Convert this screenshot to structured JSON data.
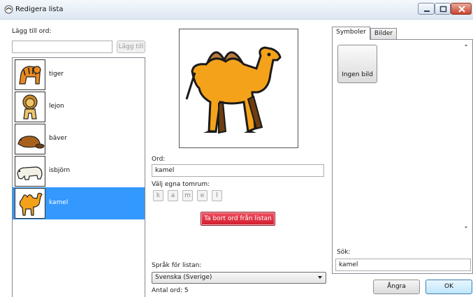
{
  "window": {
    "title": "Redigera lista"
  },
  "add_word": {
    "label": "Lägg till ord:",
    "input_value": "",
    "button": "Lägg till"
  },
  "word_list": [
    {
      "word": "tiger",
      "icon": "tiger-icon",
      "selected": false
    },
    {
      "word": "lejon",
      "icon": "lion-icon",
      "selected": false
    },
    {
      "word": "bäver",
      "icon": "beaver-icon",
      "selected": false
    },
    {
      "word": "isbjörn",
      "icon": "polar-bear-icon",
      "selected": false
    },
    {
      "word": "kamel",
      "icon": "camel-icon",
      "selected": true
    }
  ],
  "editor": {
    "preview_icon": "camel-icon",
    "word_label": "Ord:",
    "word_value": "kamel",
    "spaces_label": "Välj egna tomrum:",
    "letters": [
      "k",
      "a",
      "m",
      "e",
      "l"
    ],
    "remove_button": "Ta bort ord från listan"
  },
  "language": {
    "label": "Språk för listan:",
    "selected": "Svenska (Sverige)"
  },
  "count": {
    "text": "Antal ord: 5"
  },
  "tabs": {
    "items": [
      "Symboler",
      "Bilder"
    ],
    "active": "Symboler",
    "no_image_button": "Ingen bild",
    "search_label": "Sök:",
    "search_value": "kamel"
  },
  "footer": {
    "undo_button": "Ångra",
    "ok_button": "OK"
  },
  "colors": {
    "selection": "#3399ff",
    "remove_button": "#d9243a",
    "camel_body": "#f5a21b",
    "camel_humps": "#b97a3e"
  }
}
